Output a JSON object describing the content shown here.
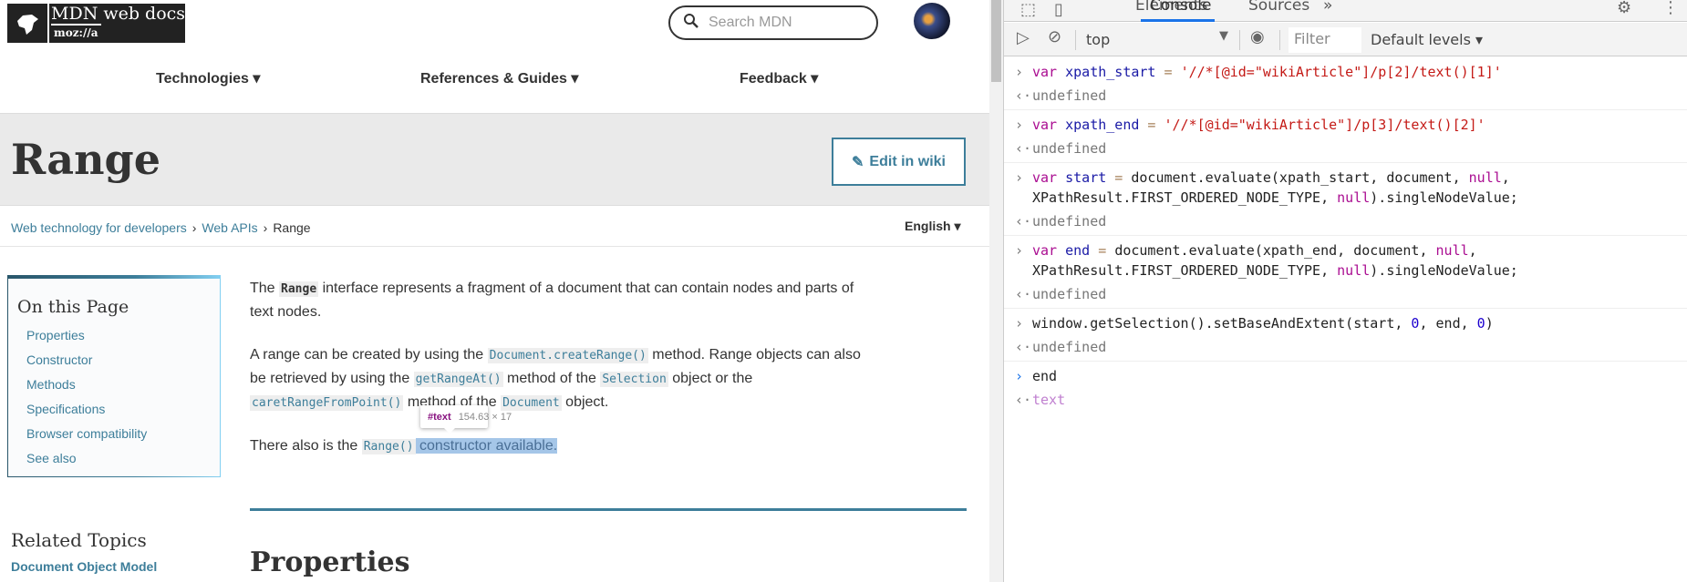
{
  "page": {
    "logo": {
      "title": "MDN web docs",
      "sub": "moz://a"
    },
    "search_placeholder": "Search MDN",
    "nav": [
      "Technologies ▾",
      "References & Guides ▾",
      "Feedback ▾"
    ],
    "title": "Range",
    "edit_label": "Edit in wiki",
    "breadcrumb": [
      "Web technology for developers",
      "Web APIs",
      "Range"
    ],
    "language": "English ▾",
    "toc": {
      "heading": "On this Page",
      "items": [
        "Properties",
        "Constructor",
        "Methods",
        "Specifications",
        "Browser compatibility",
        "See also"
      ]
    },
    "article": {
      "p1": [
        "The ",
        "Range",
        " interface represents a fragment of a document that can contain nodes and parts of text nodes."
      ],
      "p2": [
        "A range can be created by using the ",
        "Document.createRange()",
        " method. Range objects can also be retrieved by using the ",
        "getRangeAt()",
        " method of the ",
        "Selection",
        " object or the ",
        "caretRangeFromPoint()",
        " method of the ",
        "Document",
        " object."
      ],
      "p3": [
        "There also is the ",
        "Range()",
        " constructor available."
      ]
    },
    "tooltip": {
      "node": "#text",
      "size": "154.63 × 17"
    },
    "related": "Related Topics",
    "related_link": "Document Object Model",
    "section": "Properties"
  },
  "devtools": {
    "tabs": [
      "Elements",
      "Console",
      "Sources",
      "»"
    ],
    "context": "top",
    "filter_placeholder": "Filter",
    "levels": "Default levels ▾",
    "console": {
      "e1": {
        "a": "var",
        "b": " xpath_start",
        "c": " = ",
        "d": "'//*[@id=\"wikiArticle\"]/p[2]/text()[1]'",
        "r": "undefined"
      },
      "e2": {
        "a": "var",
        "b": " xpath_end",
        "c": " = ",
        "d": "'//*[@id=\"wikiArticle\"]/p[3]/text()[2]'",
        "r": "undefined"
      },
      "e3": {
        "a": "var",
        "b": " start",
        "c": " = ",
        "d": "document.evaluate(xpath_start, document, ",
        "n1": "null",
        "e": ",",
        "f": "XPathResult.FIRST_ORDERED_NODE_TYPE, ",
        "n2": "null",
        "g": ").singleNodeValue;",
        "r": "undefined"
      },
      "e4": {
        "a": "var",
        "b": " end",
        "c": " = ",
        "d": "document.evaluate(xpath_end, document, ",
        "n1": "null",
        "e": ",",
        "f": "XPathResult.FIRST_ORDERED_NODE_TYPE, ",
        "n2": "null",
        "g": ").singleNodeValue;",
        "r": "undefined"
      },
      "e5": {
        "a": "window.getSelection().setBaseAndExtent(start, ",
        "z1": "0",
        "b": ", end, ",
        "z2": "0",
        "c": ")",
        "r": "undefined"
      },
      "e6": {
        "cmd": "end",
        "r": "text"
      }
    }
  }
}
